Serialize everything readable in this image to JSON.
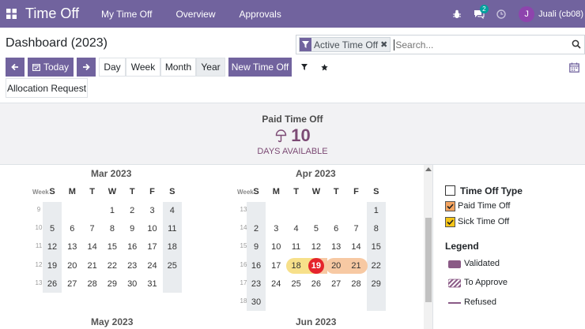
{
  "navbar": {
    "app_name": "Time Off",
    "menus": [
      "My Time Off",
      "Overview",
      "Approvals"
    ],
    "message_count": "2",
    "user_initial": "J",
    "user_name": "Juali (cb08)"
  },
  "control_panel": {
    "title": "Dashboard (2023)",
    "search": {
      "facet_label": "Active Time Off",
      "placeholder": "Search..."
    },
    "today_label": "Today",
    "scales": [
      "Day",
      "Week",
      "Month",
      "Year"
    ],
    "active_scale": "Year",
    "new_label": "New Time Off",
    "allocation_label": "Allocation Request"
  },
  "summary": {
    "title": "Paid Time Off",
    "value": "10",
    "subtitle": "DAYS AVAILABLE"
  },
  "calendar": {
    "week_header": "Week",
    "weekdays": [
      "S",
      "M",
      "T",
      "W",
      "T",
      "F",
      "S"
    ],
    "months": [
      {
        "name": "Mar 2023",
        "weeks": [
          {
            "num": "9",
            "days": [
              "",
              "",
              "",
              "1",
              "2",
              "3",
              "4"
            ]
          },
          {
            "num": "10",
            "days": [
              "5",
              "6",
              "7",
              "8",
              "9",
              "10",
              "11"
            ]
          },
          {
            "num": "11",
            "days": [
              "12",
              "13",
              "14",
              "15",
              "16",
              "17",
              "18"
            ]
          },
          {
            "num": "12",
            "days": [
              "19",
              "20",
              "21",
              "22",
              "23",
              "24",
              "25"
            ]
          },
          {
            "num": "13",
            "days": [
              "26",
              "27",
              "28",
              "29",
              "30",
              "31",
              ""
            ]
          }
        ]
      },
      {
        "name": "Apr 2023",
        "weeks": [
          {
            "num": "13",
            "days": [
              "",
              "",
              "",
              "",
              "",
              "",
              "1"
            ]
          },
          {
            "num": "14",
            "days": [
              "2",
              "3",
              "4",
              "5",
              "6",
              "7",
              "8"
            ]
          },
          {
            "num": "15",
            "days": [
              "9",
              "10",
              "11",
              "12",
              "13",
              "14",
              "15"
            ]
          },
          {
            "num": "16",
            "days": [
              "16",
              "17",
              "18",
              "19",
              "20",
              "21",
              "22"
            ]
          },
          {
            "num": "17",
            "days": [
              "23",
              "24",
              "25",
              "26",
              "27",
              "28",
              "29"
            ]
          },
          {
            "num": "18",
            "days": [
              "30",
              "",
              "",
              "",
              "",
              "",
              ""
            ]
          }
        ],
        "highlights": [
          {
            "day": "18",
            "type": "sick"
          },
          {
            "day": "19",
            "type": "today"
          },
          {
            "day": "20",
            "type": "paid"
          },
          {
            "day": "21",
            "type": "paid"
          }
        ]
      }
    ],
    "next_months": [
      "May 2023",
      "Jun 2023"
    ]
  },
  "sidebar": {
    "filter_title": "Time Off Type",
    "types": [
      {
        "label": "Paid Time Off",
        "color": "#f4a460"
      },
      {
        "label": "Sick Time Off",
        "color": "#f5c518"
      }
    ],
    "legend_title": "Legend",
    "legend": [
      {
        "label": "Validated",
        "style": "solid"
      },
      {
        "label": "To Approve",
        "style": "hatched"
      },
      {
        "label": "Refused",
        "style": "line"
      }
    ]
  },
  "colors": {
    "brand": "#71639e",
    "sick": "#f7e08a",
    "paid": "#f7c9a3",
    "today": "#e5232c",
    "legend": "#8a5a86"
  },
  "icons": {
    "apps": "grid-icon",
    "bug": "bug-icon",
    "messages": "chat-icon",
    "activity": "clock-icon",
    "prev": "arrow-left-icon",
    "next": "arrow-right-icon",
    "calendar": "calendar-icon",
    "filter": "filter-icon",
    "favorite": "star-icon",
    "search": "search-icon",
    "allocation": "scales-icon"
  }
}
